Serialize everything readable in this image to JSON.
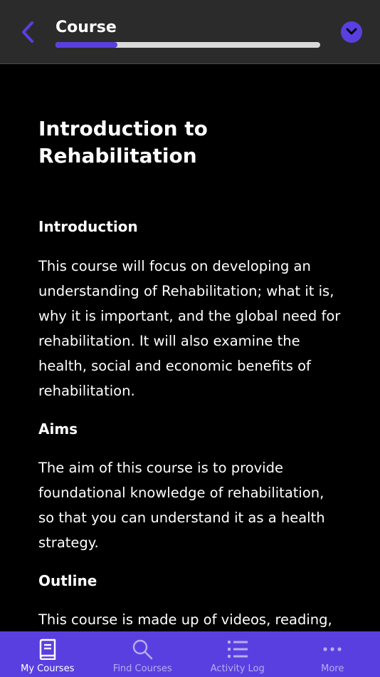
{
  "header": {
    "title": "Course",
    "progress_fraction": 0.235,
    "accent_color": "#5a3fe0"
  },
  "content": {
    "title": "Introduction to Rehabilitation",
    "sections": [
      {
        "heading": "Introduction",
        "text": "This course will focus on developing an understanding of Rehabilitation; what it is, why it is important, and the global need for rehabilitation. It will also examine the health, social and economic benefits of rehabilitation."
      },
      {
        "heading": "Aims",
        "text": "The aim of this course is to provide foundational knowledge of rehabilitation, so that you can understand it as a health strategy."
      },
      {
        "heading": "Outline",
        "text": "This course is made up of videos, reading, forum posts and a final quiz. The course"
      }
    ]
  },
  "tabbar": {
    "tabs": [
      {
        "label": "My Courses",
        "icon": "book-icon",
        "active": true
      },
      {
        "label": "Find Courses",
        "icon": "search-icon",
        "active": false
      },
      {
        "label": "Activity Log",
        "icon": "list-icon",
        "active": false
      },
      {
        "label": "More",
        "icon": "more-icon",
        "active": false
      }
    ]
  }
}
